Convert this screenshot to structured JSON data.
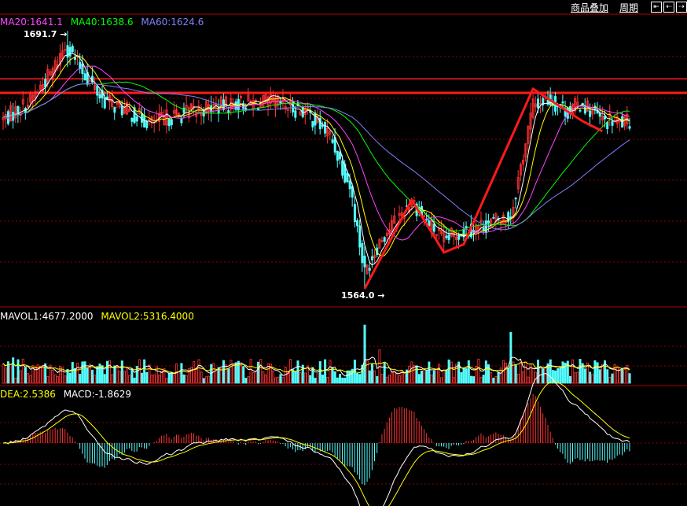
{
  "toolbar": {
    "overlay_label": "商品叠加",
    "period_label": "周期"
  },
  "price_legend": {
    "ma20": "MA20:1641.1",
    "ma40": "MA40:1638.6",
    "ma60": "MA60:1624.6"
  },
  "volume_legend": {
    "mavol1": "MAVOL1:4677.2000",
    "mavol2": "MAVOL2:5316.4000"
  },
  "macd_legend": {
    "dea": "DEA:2.5386",
    "macd": "MACD:-1.8629"
  },
  "annotations": {
    "high": "1691.7",
    "low": "1564.0"
  },
  "colors": {
    "up": "#ff3333",
    "down": "#54ffff",
    "ma5": "#ffffff",
    "ma10": "#ffff00",
    "ma20": "#ff44ff",
    "ma40": "#00ff00",
    "ma60": "#8080ff",
    "grid": "#8b0000",
    "border": "#b00000",
    "trend": "#ff1a1a"
  },
  "chart_data": [
    {
      "type": "candlestick",
      "panel": "price",
      "ylim": [
        1555,
        1700
      ],
      "high_label": 1691.7,
      "low_label": 1564.0,
      "resistance": [
        1668,
        1661
      ],
      "ma_series": [
        {
          "name": "MA20",
          "last": 1641.1
        },
        {
          "name": "MA40",
          "last": 1638.6
        },
        {
          "name": "MA60",
          "last": 1624.6
        }
      ],
      "close_anchors": [
        [
          0,
          1648
        ],
        [
          10,
          1656
        ],
        [
          20,
          1672
        ],
        [
          25,
          1685
        ],
        [
          32,
          1672
        ],
        [
          40,
          1658
        ],
        [
          50,
          1652
        ],
        [
          60,
          1646
        ],
        [
          70,
          1650
        ],
        [
          80,
          1653
        ],
        [
          95,
          1656
        ],
        [
          110,
          1656
        ],
        [
          122,
          1652
        ],
        [
          132,
          1640
        ],
        [
          140,
          1615
        ],
        [
          146,
          1572
        ],
        [
          152,
          1588
        ],
        [
          160,
          1600
        ],
        [
          165,
          1608
        ],
        [
          172,
          1596
        ],
        [
          178,
          1588
        ],
        [
          184,
          1592
        ],
        [
          195,
          1596
        ],
        [
          205,
          1600
        ],
        [
          214,
          1655
        ],
        [
          220,
          1658
        ],
        [
          228,
          1652
        ],
        [
          234,
          1656
        ],
        [
          242,
          1647
        ],
        [
          253,
          1646
        ]
      ],
      "n_bars": 254
    },
    {
      "type": "bar",
      "panel": "volume",
      "ylim": [
        0,
        20000
      ],
      "ma_series": [
        {
          "name": "MAVOL1",
          "last": 4677.2
        },
        {
          "name": "MAVOL2",
          "last": 5316.4
        }
      ],
      "spikes": [
        [
          4,
          8400
        ],
        [
          8,
          8000
        ],
        [
          94,
          6800
        ],
        [
          119,
          7400
        ],
        [
          146,
          19200
        ],
        [
          152,
          11000
        ],
        [
          205,
          16800
        ],
        [
          207,
          6000
        ]
      ]
    },
    {
      "type": "line",
      "panel": "macd",
      "ylim": [
        -14,
        10
      ],
      "series": [
        {
          "name": "DEA",
          "last": 2.5386
        },
        {
          "name": "MACD",
          "last": -1.8629
        }
      ]
    }
  ]
}
